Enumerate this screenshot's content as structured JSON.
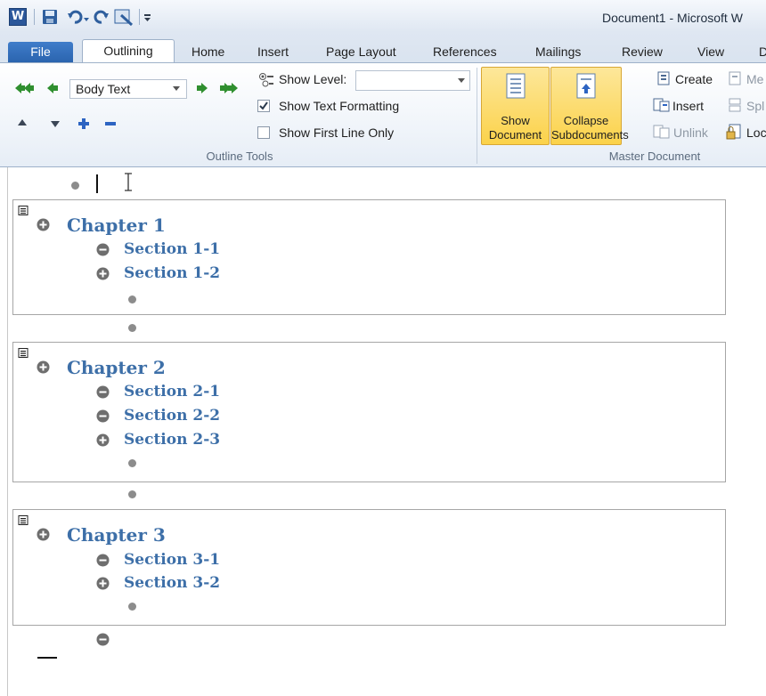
{
  "window": {
    "title": "Document1  -  Microsoft W"
  },
  "tabs": {
    "file": "File",
    "outlining": "Outlining",
    "home": "Home",
    "insert": "Insert",
    "page_layout": "Page Layout",
    "references": "References",
    "mailings": "Mailings",
    "review": "Review",
    "view": "View",
    "more": "D"
  },
  "outline_tools": {
    "label": "Outline Tools",
    "level_value": "Body Text",
    "show_level_label": "Show Level:",
    "show_level_value": "",
    "show_text_formatting": "Show Text Formatting",
    "show_text_formatting_checked": true,
    "show_first_line_only": "Show First Line Only",
    "show_first_line_only_checked": false
  },
  "master_document": {
    "label": "Master Document",
    "show_document_line1": "Show",
    "show_document_line2": "Document",
    "collapse_line1": "Collapse",
    "collapse_line2": "Subdocuments",
    "create": "Create",
    "insert": "Insert",
    "unlink": "Unlink",
    "merge": "Me",
    "split": "Spl",
    "lock": "Loc"
  },
  "document": {
    "chapters": [
      {
        "title": "Chapter 1",
        "sections": [
          {
            "title": "Section 1-1",
            "state": "minus"
          },
          {
            "title": "Section 1-2",
            "state": "plus"
          }
        ]
      },
      {
        "title": "Chapter 2",
        "sections": [
          {
            "title": "Section 2-1",
            "state": "minus"
          },
          {
            "title": "Section 2-2",
            "state": "minus"
          },
          {
            "title": "Section 2-3",
            "state": "plus"
          }
        ]
      },
      {
        "title": "Chapter 3",
        "sections": [
          {
            "title": "Section 3-1",
            "state": "minus"
          },
          {
            "title": "Section 3-2",
            "state": "plus"
          }
        ]
      }
    ]
  },
  "colors": {
    "heading": "#3d6fa8",
    "file_tab": "#2a63ad",
    "highlight": "#fbd24a"
  }
}
